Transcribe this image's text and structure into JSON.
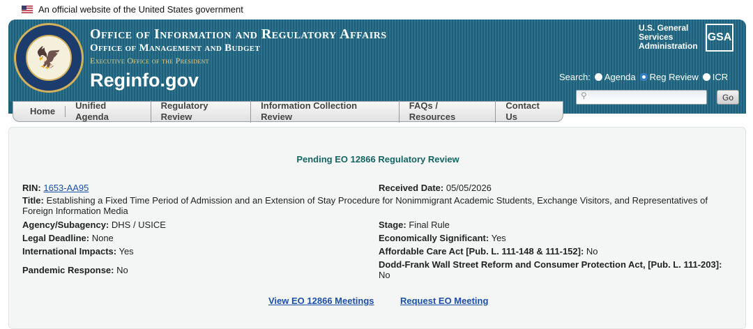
{
  "gov_banner": {
    "text": "An official website of the United States government"
  },
  "header": {
    "oira_title": "Office of Information and Regulatory Affairs",
    "omb_title": "Office of Management and Budget",
    "eop_title": "Executive Office of the President",
    "site_name": "Reginfo.gov",
    "gsa_line1": "U.S. General",
    "gsa_line2": "Services",
    "gsa_line3": "Administration",
    "gsa_logo": "GSA",
    "search": {
      "label": "Search:",
      "options": [
        "Agenda",
        "Reg Review",
        "ICR"
      ],
      "selected": "Reg Review",
      "placeholder": "",
      "go_label": "Go"
    }
  },
  "nav": {
    "items": [
      "Home",
      "Unified Agenda",
      "Regulatory Review",
      "Information Collection Review",
      "FAQs / Resources",
      "Contact Us"
    ]
  },
  "review": {
    "heading": "Pending EO 12866 Regulatory Review",
    "rin_label": "RIN:",
    "rin_value": "1653-AA95",
    "received_label": "Received Date:",
    "received_value": "05/05/2026",
    "title_label": "Title:",
    "title_value": "Establishing a Fixed Time Period of Admission and an Extension of Stay Procedure for Nonimmigrant Academic Students, Exchange Visitors, and Representatives of Foreign Information Media",
    "agency_label": "Agency/Subagency:",
    "agency_value": "DHS / USICE",
    "stage_label": "Stage:",
    "stage_value": "Final Rule",
    "legal_label": "Legal Deadline:",
    "legal_value": "None",
    "econ_label": "Economically Significant:",
    "econ_value": "Yes",
    "intl_label": "International Impacts:",
    "intl_value": "Yes",
    "aca_label": "Affordable Care Act [Pub. L. 111-148 & 111-152]:",
    "aca_value": "No",
    "pandemic_label": "Pandemic Response:",
    "pandemic_value": "No",
    "dodd_label": "Dodd-Frank Wall Street Reform and Consumer Protection Act, [Pub. L. 111-203]:",
    "dodd_value": "No",
    "view_meetings": "View EO 12866 Meetings",
    "request_meeting": "Request EO Meeting"
  },
  "colors": {
    "header_bg": "#1f5f78",
    "heading_teal": "#146461",
    "link_blue": "#1a4fa8"
  }
}
